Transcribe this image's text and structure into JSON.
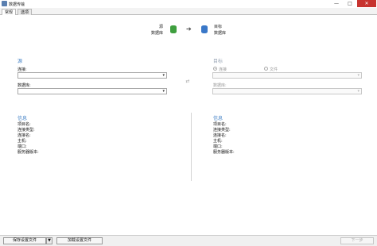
{
  "window": {
    "title": "数据传输",
    "min": "—",
    "max": "□",
    "close": "✕"
  },
  "tabs": [
    {
      "label": "常规"
    },
    {
      "label": "选项"
    }
  ],
  "flow": {
    "source_label": "源",
    "source_sub": "数据库",
    "target_label": "目标",
    "target_sub": "数据库",
    "arrow": "➔"
  },
  "source": {
    "heading": "源",
    "connection_label": "连接:",
    "connection_value": "",
    "database_label": "数据库:",
    "database_value": ""
  },
  "target": {
    "heading": "目标",
    "radio_connection": "连接",
    "radio_file": "文件",
    "database_label": "数据库:",
    "connection_value": "",
    "database_value": ""
  },
  "source_info": {
    "heading": "信息",
    "lines": [
      "项目名:",
      "连接类型:",
      "连接名:",
      "主机:",
      "端口:",
      "服务器版本:"
    ]
  },
  "target_info": {
    "heading": "信息",
    "lines": [
      "项目名:",
      "连接类型:",
      "连接名:",
      "主机:",
      "端口:",
      "服务器版本:"
    ]
  },
  "footer": {
    "save_label": "保存设置文件",
    "save_drop": "▼",
    "load_label": "加载设置文件",
    "next_label": "下一步"
  },
  "icons": {
    "swap": "⇄",
    "caret": "▾"
  }
}
